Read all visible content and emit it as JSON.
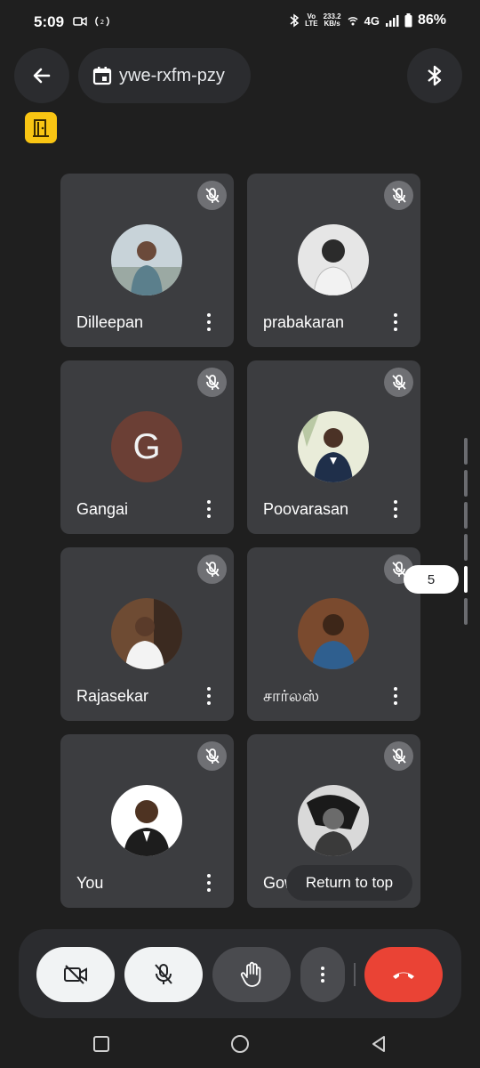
{
  "status_bar": {
    "time": "5:09",
    "volte_top": "Vo",
    "volte_bottom": "LTE",
    "speed_value": "233.2",
    "speed_unit": "KB/s",
    "network": "4G",
    "battery": "86%"
  },
  "header": {
    "meeting_code": "ywe-rxfm-pzy"
  },
  "participants": [
    {
      "name": "Dilleepan",
      "avatar": "photo",
      "muted": true
    },
    {
      "name": "prabakaran",
      "avatar": "photo",
      "muted": true
    },
    {
      "name": "Gangai",
      "avatar": "letter",
      "letter": "G",
      "muted": true
    },
    {
      "name": "Poovarasan",
      "avatar": "photo",
      "muted": true
    },
    {
      "name": "Rajasekar",
      "avatar": "photo",
      "muted": true
    },
    {
      "name": "சார்லஸ்",
      "avatar": "photo",
      "muted": true
    },
    {
      "name": "You",
      "avatar": "photo",
      "muted": true
    },
    {
      "name": "Gow",
      "avatar": "photo",
      "muted": true
    }
  ],
  "scroll": {
    "page_label": "5"
  },
  "return_to_top_label": "Return to top",
  "controls": {
    "camera": "camera-off-icon",
    "mic": "mic-off-icon",
    "raise_hand": "hand-icon",
    "more": "more-vert-icon",
    "end_call": "end-call-icon"
  },
  "colors": {
    "background": "#1f1f1f",
    "tile": "#3c3d40",
    "end_call": "#ea4335",
    "badge": "#f9c513"
  }
}
